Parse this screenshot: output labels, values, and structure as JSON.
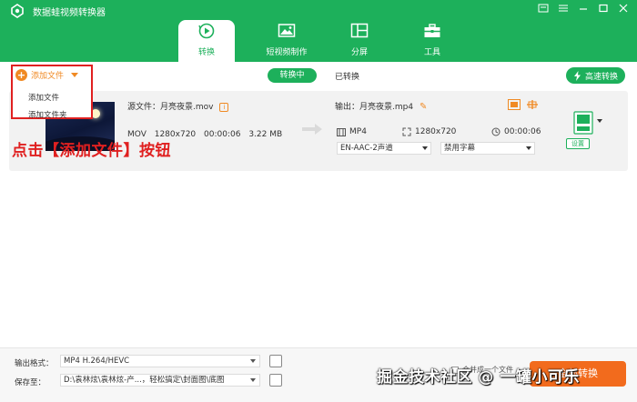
{
  "app": {
    "title": "数据蛙视频转换器"
  },
  "tabs": [
    {
      "label": "转换",
      "icon": "convert-icon",
      "active": true
    },
    {
      "label": "短视频制作",
      "icon": "image-icon",
      "active": false
    },
    {
      "label": "分屏",
      "icon": "split-screen-icon",
      "active": false
    },
    {
      "label": "工具",
      "icon": "toolbox-icon",
      "active": false
    }
  ],
  "toolbar": {
    "add_file_label": "添加文件",
    "menu": [
      "添加文件",
      "添加文件夹"
    ],
    "converting_label": "转换中",
    "converted_label": "已转换",
    "fast_convert_label": "高速转换"
  },
  "file": {
    "source_name": "源文件：月亮夜景.mov",
    "source_format": "MOV",
    "source_resolution": "1280x720",
    "source_duration": "00:00:06",
    "source_size": "3.22 MB",
    "output_name": "输出：月亮夜景.mp4",
    "output_format": "MP4",
    "output_resolution": "1280x720",
    "output_duration": "00:00:06",
    "audio_track": "EN-AAC-2声道",
    "subtitle": "禁用字幕",
    "settings_label": "设置"
  },
  "annotation": "点击【添加文件】按钮",
  "bottom": {
    "output_format_label": "输出格式：",
    "output_format_value": "MP4 H.264/HEVC",
    "save_to_label": "保存至：",
    "save_to_value": "D:\\袁林炫\\袁林炫-产...，轻松搞定\\封面图\\底图",
    "merge_label": "合并成一个文件",
    "convert_label": "全部转换"
  },
  "watermark": "掘金技术社区 @ 一罐小可乐",
  "colors": {
    "brand": "#1db05b",
    "accent": "#f08a24",
    "annotation": "#e02020",
    "convert": "#f26b1d"
  }
}
